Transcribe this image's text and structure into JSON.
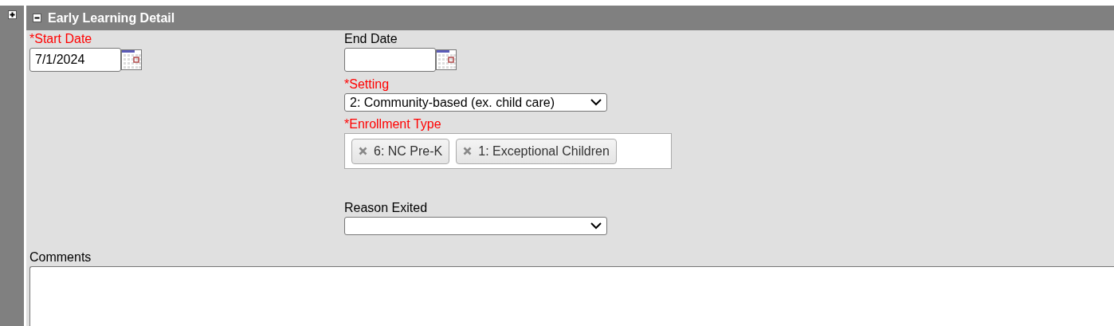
{
  "panel": {
    "title": "Early Learning Detail",
    "expanded": true
  },
  "start_date": {
    "label": "*Start Date",
    "required": true,
    "value": "7/1/2024"
  },
  "end_date": {
    "label": "End Date",
    "required": false
  },
  "setting": {
    "label": "*Setting",
    "required": true,
    "value": "2: Community-based (ex. child care)"
  },
  "enrollment_type": {
    "label": "*Enrollment Type",
    "required": true,
    "tags": [
      {
        "label": "6: NC Pre-K"
      },
      {
        "label": "1: Exceptional Children"
      }
    ]
  },
  "reason_exited": {
    "label": "Reason Exited",
    "required": false
  },
  "comments": {
    "label": "Comments"
  }
}
